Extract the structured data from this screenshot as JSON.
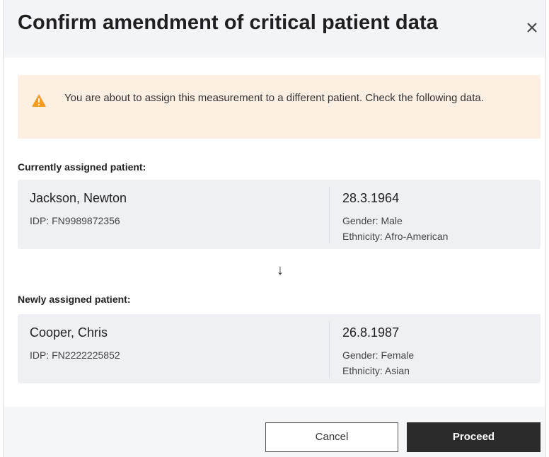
{
  "dialog": {
    "title": "Confirm amendment of critical patient data",
    "close_icon": "close-icon"
  },
  "warning": {
    "icon": "warning-triangle-icon",
    "icon_color": "#f59a23",
    "background": "#fdefe2",
    "text": "You are about to assign this measurement to a different patient. Check the following data."
  },
  "current": {
    "label": "Currently assigned patient:",
    "name": "Jackson, Newton",
    "idp": "IDP: FN9989872356",
    "dob": "28.3.1964",
    "gender": "Gender: Male",
    "ethnicity": "Ethnicity: Afro-American"
  },
  "arrow": {
    "icon": "arrow-down-icon",
    "glyph": "↓"
  },
  "new": {
    "label": "Newly assigned patient:",
    "name": "Cooper, Chris",
    "idp": "IDP: FN2222225852",
    "dob": "26.8.1987",
    "gender": "Gender: Female",
    "ethnicity": "Ethnicity: Asian"
  },
  "footer": {
    "cancel_label": "Cancel",
    "proceed_label": "Proceed",
    "proceed_color": "#2b2b2b"
  }
}
